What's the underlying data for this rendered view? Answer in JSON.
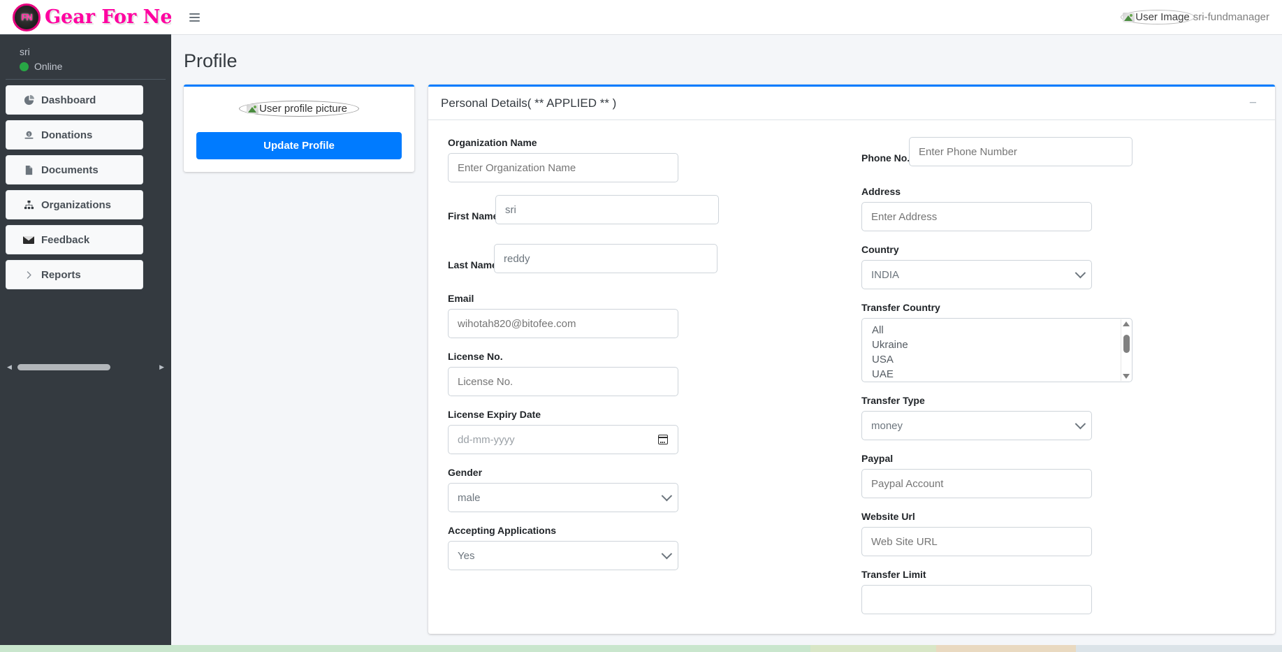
{
  "brand": {
    "mark": "FN",
    "name": "Gear For Need"
  },
  "sidebar": {
    "user": {
      "name": "sri",
      "status": "Online"
    },
    "items": [
      {
        "label": "Dashboard",
        "icon": "pie-chart-icon"
      },
      {
        "label": "Donations",
        "icon": "donation-icon"
      },
      {
        "label": "Documents",
        "icon": "document-icon"
      },
      {
        "label": "Organizations",
        "icon": "sitemap-icon"
      },
      {
        "label": "Feedback",
        "icon": "envelope-icon"
      },
      {
        "label": "Reports",
        "icon": "chevron-right-icon"
      }
    ]
  },
  "topbar": {
    "menu_icon": "hamburger-icon",
    "avatar_alt": "User Image",
    "username": "sri-fundmanager"
  },
  "page": {
    "title": "Profile"
  },
  "profile_card": {
    "image_alt": "User profile picture",
    "update_button": "Update Profile"
  },
  "details": {
    "title": "Personal Details( ** APPLIED ** )",
    "minimize_icon": "minimize-icon",
    "left": {
      "organization_name": {
        "label": "Organization Name",
        "placeholder": "Enter Organization Name",
        "value": ""
      },
      "first_name": {
        "label": "First Name",
        "value": "sri"
      },
      "last_name": {
        "label": "Last Name",
        "value": "reddy"
      },
      "email": {
        "label": "Email",
        "placeholder": "wihotah820@bitofee.com",
        "value": ""
      },
      "license_no": {
        "label": "License No.",
        "placeholder": "License No.",
        "value": ""
      },
      "license_expiry": {
        "label": "License Expiry Date",
        "placeholder": "dd-mm-yyyy",
        "value": ""
      },
      "gender": {
        "label": "Gender",
        "value": "male"
      },
      "accepting_applications": {
        "label": "Accepting Applications",
        "value": "Yes"
      }
    },
    "right": {
      "phone": {
        "label": "Phone No.",
        "placeholder": "Enter Phone Number",
        "value": ""
      },
      "address": {
        "label": "Address",
        "placeholder": "Enter Address",
        "value": ""
      },
      "country": {
        "label": "Country",
        "value": "INDIA"
      },
      "transfer_country": {
        "label": "Transfer Country",
        "options": [
          "All",
          "Ukraine",
          "USA",
          "UAE"
        ]
      },
      "transfer_type": {
        "label": "Transfer Type",
        "value": "money"
      },
      "paypal": {
        "label": "Paypal",
        "placeholder": "Paypal Account",
        "value": ""
      },
      "website_url": {
        "label": "Website Url",
        "placeholder": "Web Site URL",
        "value": ""
      },
      "transfer_limit": {
        "label": "Transfer Limit",
        "value": ""
      }
    }
  },
  "colors": {
    "accent": "#007bff",
    "sidebar_bg": "#343a40",
    "brand_pink": "#ff00a0",
    "online_green": "#28a745"
  }
}
